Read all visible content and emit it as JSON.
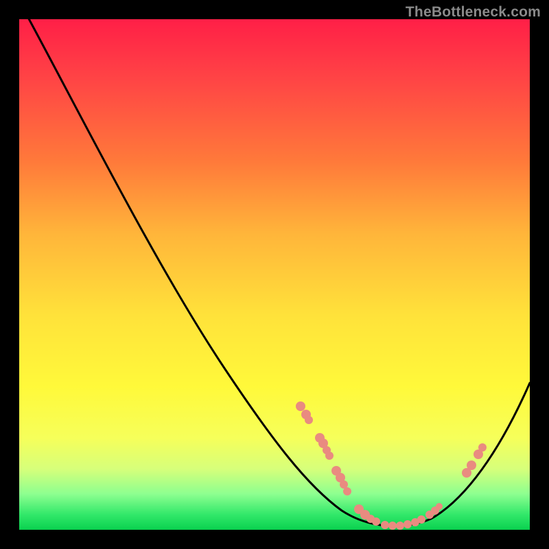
{
  "watermark": "TheBottleneck.com",
  "chart_data": {
    "type": "line",
    "title": "",
    "xlabel": "",
    "ylabel": "",
    "ylim": [
      0,
      100
    ],
    "xlim": [
      0,
      100
    ],
    "series": [
      {
        "name": "curve",
        "x": [
          0,
          10,
          20,
          30,
          40,
          50,
          55,
          60,
          65,
          70,
          75,
          80,
          85,
          90,
          95,
          100
        ],
        "y": [
          100,
          88,
          75,
          62,
          49,
          35,
          27,
          18,
          9,
          3,
          0,
          2,
          7,
          15,
          24,
          34
        ]
      }
    ],
    "marker_clusters": [
      {
        "name": "left-descent",
        "approx_x": 56,
        "approx_y": 24,
        "count": 3
      },
      {
        "name": "left-descent-low",
        "approx_x": 60,
        "approx_y": 16,
        "count": 4
      },
      {
        "name": "pre-valley",
        "approx_x": 63,
        "approx_y": 10,
        "count": 4
      },
      {
        "name": "valley-floor-left",
        "approx_x": 68,
        "approx_y": 3,
        "count": 4
      },
      {
        "name": "valley-floor-mid",
        "approx_x": 74,
        "approx_y": 1,
        "count": 6
      },
      {
        "name": "valley-floor-right",
        "approx_x": 79,
        "approx_y": 2,
        "count": 3
      },
      {
        "name": "right-ascent-low",
        "approx_x": 87,
        "approx_y": 12,
        "count": 2
      },
      {
        "name": "right-ascent",
        "approx_x": 89,
        "approx_y": 16,
        "count": 2
      }
    ],
    "colors": {
      "gradient_top": "#ff1f47",
      "gradient_bottom": "#0ad14f",
      "curve": "#000000",
      "markers": "#e98b80",
      "frame": "#000000"
    }
  }
}
